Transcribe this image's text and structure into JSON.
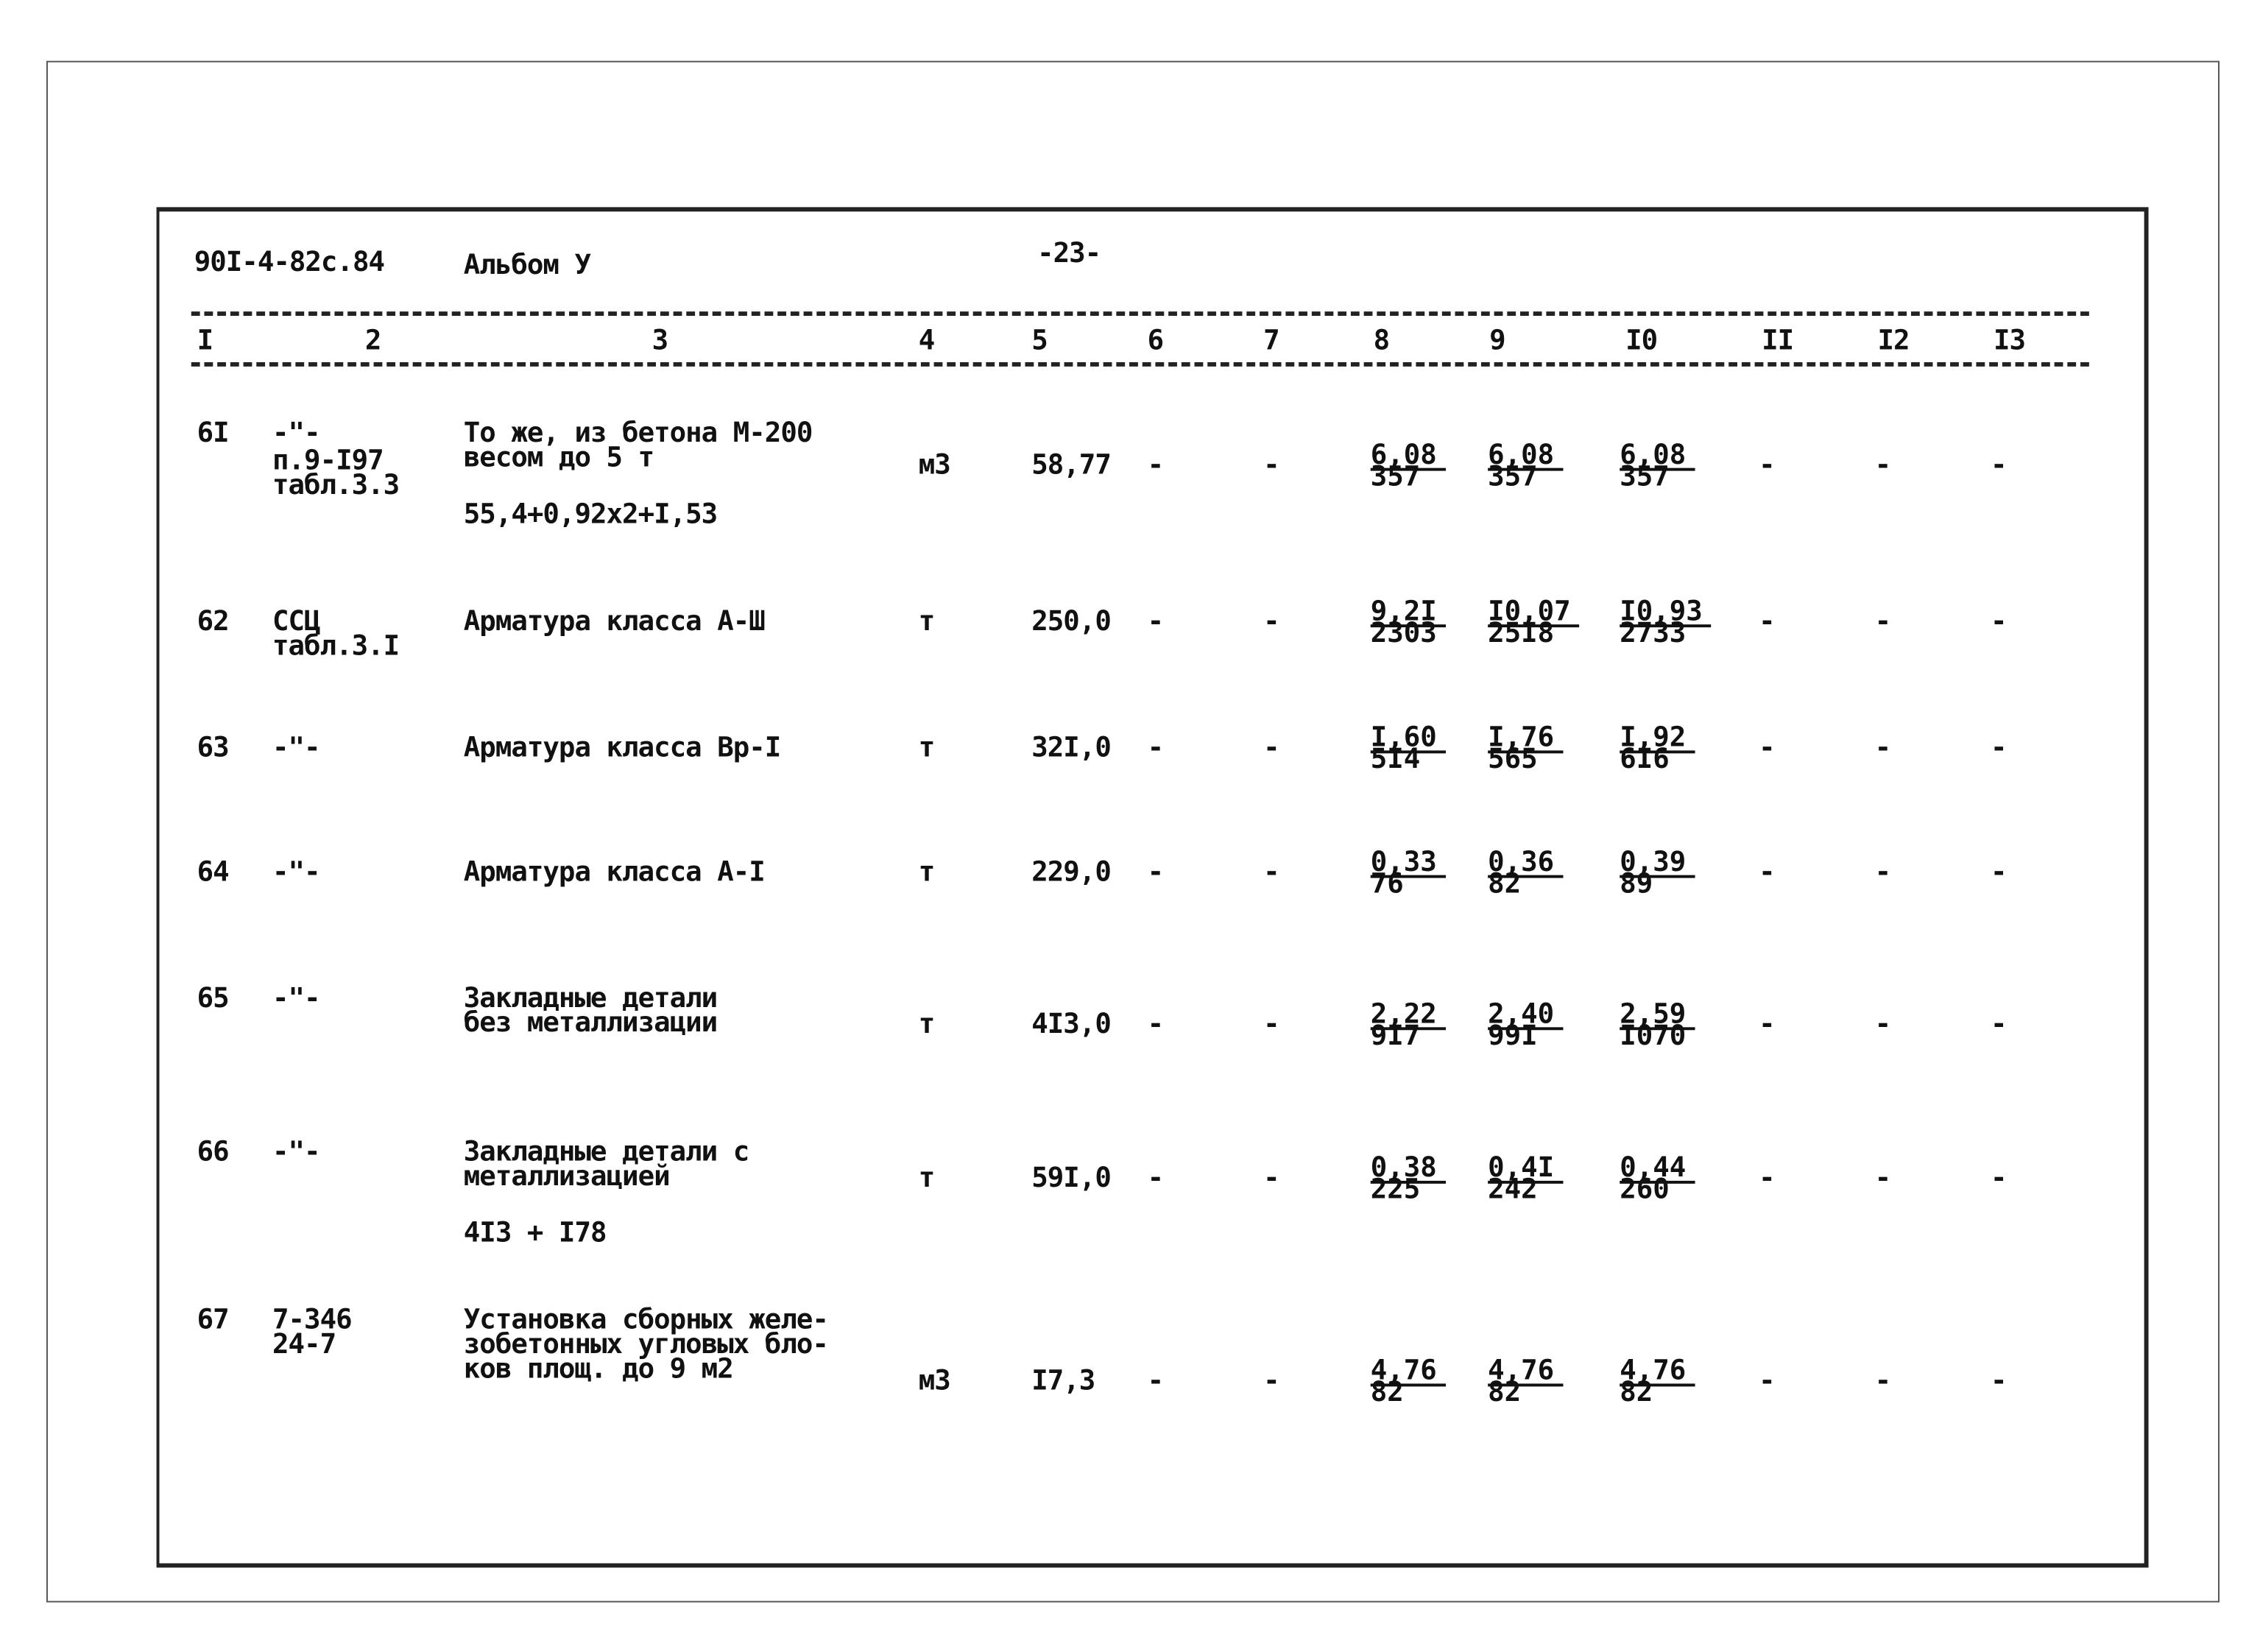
{
  "header": {
    "doc_code": "90I-4-82с.84",
    "album": "Альбом У",
    "page": "-23-"
  },
  "column_numbers": [
    "I",
    "2",
    "3",
    "4",
    "5",
    "6",
    "7",
    "8",
    "9",
    "I0",
    "II",
    "I2",
    "I3"
  ],
  "rows": [
    {
      "no": "6I",
      "ref": [
        "-\"-",
        "п.9-I97",
        "табл.3.3"
      ],
      "name": [
        "То же, из бетона М-200",
        "весом до 5 т"
      ],
      "formula": "55,4+0,92x2+I,53",
      "unit": "м3",
      "price": "58,77",
      "c6": "-",
      "c7": "-",
      "c8": [
        "6,08",
        "357"
      ],
      "c9": [
        "6,08",
        "357"
      ],
      "c10": [
        "6,08",
        "357"
      ],
      "c11": "-",
      "c12": "-",
      "c13": "-"
    },
    {
      "no": "62",
      "ref": [
        "ССЦ",
        "табл.3.I"
      ],
      "name": [
        "Арматура класса А-Ш"
      ],
      "formula": "",
      "unit": "т",
      "price": "250,0",
      "c6": "-",
      "c7": "-",
      "c8": [
        "9,2I",
        "2303"
      ],
      "c9": [
        "I0,07",
        "25I8"
      ],
      "c10": [
        "I0,93",
        "2733"
      ],
      "c11": "-",
      "c12": "-",
      "c13": "-"
    },
    {
      "no": "63",
      "ref": [
        "-\"-"
      ],
      "name": [
        "Арматура класса Вр-I"
      ],
      "formula": "",
      "unit": "т",
      "price": "32I,0",
      "c6": "-",
      "c7": "-",
      "c8": [
        "I,60",
        "5I4"
      ],
      "c9": [
        "I,76",
        "565"
      ],
      "c10": [
        "I,92",
        "6I6"
      ],
      "c11": "-",
      "c12": "-",
      "c13": "-"
    },
    {
      "no": "64",
      "ref": [
        "-\"-"
      ],
      "name": [
        "Арматура класса А-I"
      ],
      "formula": "",
      "unit": "т",
      "price": "229,0",
      "c6": "-",
      "c7": "-",
      "c8": [
        "0,33",
        "76"
      ],
      "c9": [
        "0,36",
        "82"
      ],
      "c10": [
        "0,39",
        "89"
      ],
      "c11": "-",
      "c12": "-",
      "c13": "-"
    },
    {
      "no": "65",
      "ref": [
        "-\"-"
      ],
      "name": [
        "Закладные детали",
        "без металлизации"
      ],
      "formula": "",
      "unit": "т",
      "price": "4I3,0",
      "c6": "-",
      "c7": "-",
      "c8": [
        "2,22",
        "9I7"
      ],
      "c9": [
        "2,40",
        "99I"
      ],
      "c10": [
        "2,59",
        "I070"
      ],
      "c11": "-",
      "c12": "-",
      "c13": "-"
    },
    {
      "no": "66",
      "ref": [
        "-\"-"
      ],
      "name": [
        "Закладные детали с",
        "металлизацией"
      ],
      "formula": "4I3 + I78",
      "unit": "т",
      "price": "59I,0",
      "c6": "-",
      "c7": "-",
      "c8": [
        "0,38",
        "225"
      ],
      "c9": [
        "0,4I",
        "242"
      ],
      "c10": [
        "0,44",
        "260"
      ],
      "c11": "-",
      "c12": "-",
      "c13": "-"
    },
    {
      "no": "67",
      "ref": [
        "7-346",
        "24-7"
      ],
      "name": [
        "Установка сборных желе-",
        "зобетонных угловых бло-",
        "ков площ. до 9 м2"
      ],
      "formula": "",
      "unit": "м3",
      "price": "I7,3",
      "c6": "-",
      "c7": "-",
      "c8": [
        "4,76",
        "82"
      ],
      "c9": [
        "4,76",
        "82"
      ],
      "c10": [
        "4,76",
        "82"
      ],
      "c11": "-",
      "c12": "-",
      "c13": "-"
    }
  ]
}
